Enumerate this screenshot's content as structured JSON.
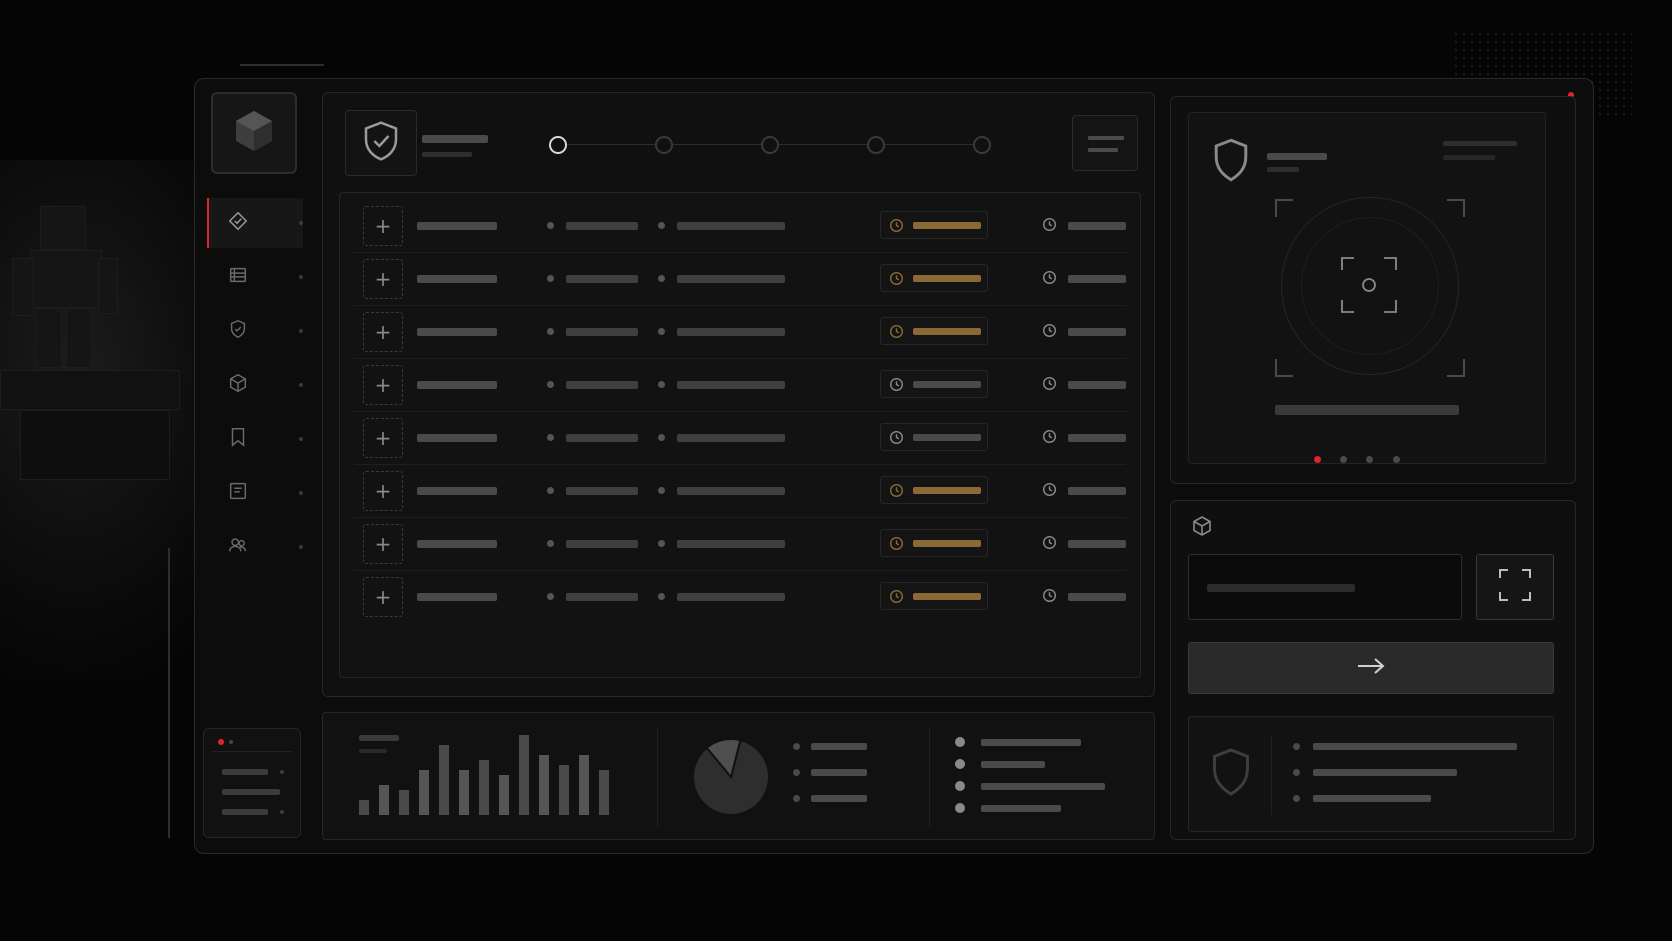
{
  "app": {
    "theme": "dark",
    "accent_color": "#e0242b",
    "warning_color": "#8a6a34",
    "text_color": "#4a4a4a"
  },
  "sidebar": {
    "logo_icon": "cube-logo-icon",
    "active_index": 0,
    "items": [
      {
        "icon": "shield-diamond-icon"
      },
      {
        "icon": "list-icon"
      },
      {
        "icon": "shield-check-icon"
      },
      {
        "icon": "cube-icon"
      },
      {
        "icon": "bookmark-icon"
      },
      {
        "icon": "message-icon"
      },
      {
        "icon": "users-icon"
      }
    ]
  },
  "header": {
    "icon": "shield-check-icon",
    "stepper": {
      "steps": 5,
      "current": 1
    },
    "menu_icon": "menu-icon"
  },
  "table": {
    "rows": [
      {
        "status": "warning"
      },
      {
        "status": "warning"
      },
      {
        "status": "warning"
      },
      {
        "status": "neutral"
      },
      {
        "status": "neutral"
      },
      {
        "status": "warning"
      },
      {
        "status": "warning"
      },
      {
        "status": "warning"
      }
    ]
  },
  "chart_data": {
    "type": "bar",
    "values": [
      3,
      6,
      5,
      9,
      14,
      9,
      11,
      8,
      16,
      12,
      10,
      12,
      9
    ],
    "title": "",
    "xlabel": "",
    "ylabel": ""
  },
  "pie_data": {
    "type": "pie",
    "slices": [
      85,
      15
    ]
  },
  "carousel": {
    "count": 4,
    "active": 0
  },
  "scanner": {
    "icon": "shield-icon",
    "target_icon": "crosshair-icon"
  },
  "action_panel": {
    "icon": "cube-icon",
    "expand_icon": "expand-icon",
    "submit_icon": "arrow-right-icon",
    "card_icon": "shield-icon"
  }
}
